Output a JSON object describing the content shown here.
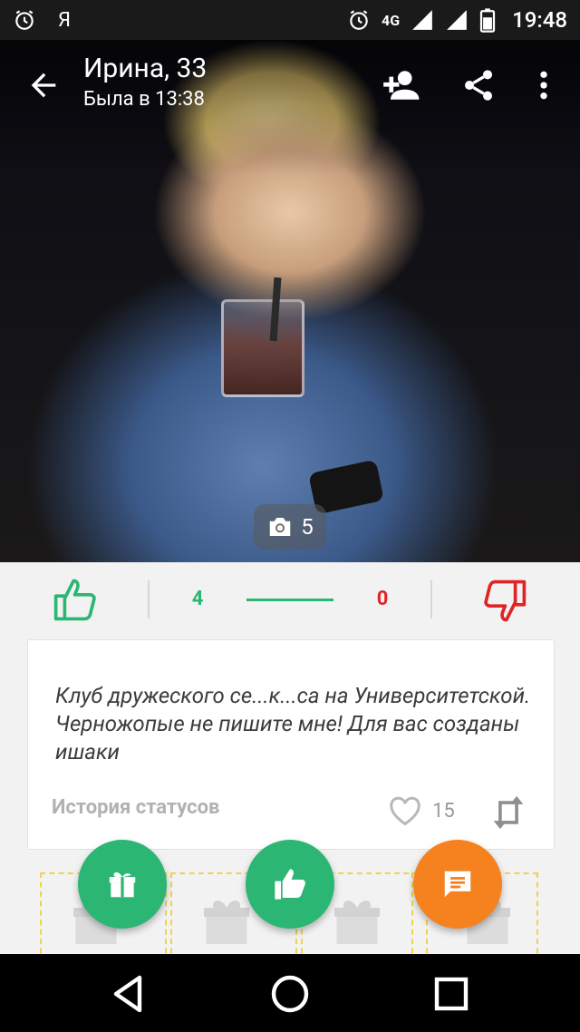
{
  "status_bar": {
    "left_icons": [
      "alarm-icon",
      "yandex-icon"
    ],
    "yandex_glyph": "Я",
    "network": "4G",
    "time": "19:48"
  },
  "profile": {
    "name_age": "Ирина, 33",
    "last_seen": "Была  в 13:38",
    "photo_count": "5"
  },
  "toolbar": {
    "icons": [
      "back-arrow-icon",
      "add-friend-icon",
      "share-icon",
      "more-vert-icon"
    ]
  },
  "rating": {
    "likes": "4",
    "dislikes": "0",
    "like_share": 1.0,
    "colors": {
      "like": "#2bb673",
      "dislike": "#e02424"
    }
  },
  "status_card": {
    "text": "Клуб дружеского се...к...са на Университетской. Черножопые не пишите мне! Для вас созданы ишаки",
    "history_label": "История статусов",
    "likes_count": "15"
  },
  "actions": {
    "icons": [
      "gift-icon",
      "thumbs-up-icon",
      "chat-icon"
    ],
    "colors": {
      "gift": "#2bb673",
      "like": "#2bb673",
      "chat": "#f6821f"
    }
  },
  "nav": {
    "icons": [
      "back-triangle-icon",
      "home-circle-icon",
      "recents-square-icon"
    ]
  }
}
